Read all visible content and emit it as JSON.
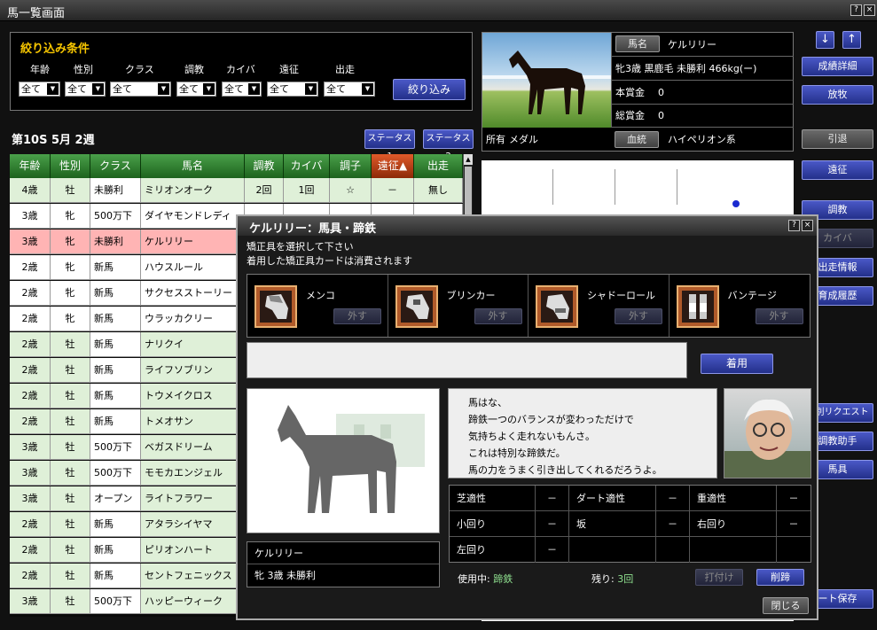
{
  "window": {
    "title": "馬一覧画面",
    "help": "?",
    "close": "×"
  },
  "filter": {
    "title": "絞り込み条件",
    "labels": [
      "年齢",
      "性別",
      "クラス",
      "調教",
      "カイバ",
      "遠征",
      "出走"
    ],
    "values": [
      "全て",
      "全て",
      "全て",
      "全て",
      "全て",
      "全て",
      "全て"
    ],
    "button": "絞り込み"
  },
  "period": "第10S  5月 2週",
  "status_buttons": {
    "s1": "ステータス1",
    "s2": "ステータス2"
  },
  "table": {
    "headers": [
      "年齢",
      "性別",
      "クラス",
      "馬名",
      "調教",
      "カイバ",
      "調子",
      "遠征▲",
      "出走"
    ],
    "rows": [
      {
        "age": "4歳",
        "sex": "牡",
        "cls": "未勝利",
        "name": "ミリオンオーク",
        "train": "2回",
        "feed": "1回",
        "cond": "☆",
        "exp": "－",
        "run": "無し"
      },
      {
        "age": "3歳",
        "sex": "牝",
        "cls": "500万下",
        "name": "ダイヤモンドレディ"
      },
      {
        "age": "3歳",
        "sex": "牝",
        "cls": "未勝利",
        "name": "ケルリリー"
      },
      {
        "age": "2歳",
        "sex": "牝",
        "cls": "新馬",
        "name": "ハウスルール"
      },
      {
        "age": "2歳",
        "sex": "牝",
        "cls": "新馬",
        "name": "サクセスストーリー"
      },
      {
        "age": "2歳",
        "sex": "牝",
        "cls": "新馬",
        "name": "ウラッカクリー"
      },
      {
        "age": "2歳",
        "sex": "牡",
        "cls": "新馬",
        "name": "ナリクイ"
      },
      {
        "age": "2歳",
        "sex": "牡",
        "cls": "新馬",
        "name": "ライフソブリン"
      },
      {
        "age": "2歳",
        "sex": "牡",
        "cls": "新馬",
        "name": "トウメイクロス"
      },
      {
        "age": "2歳",
        "sex": "牡",
        "cls": "新馬",
        "name": "トメオサン"
      },
      {
        "age": "3歳",
        "sex": "牡",
        "cls": "500万下",
        "name": "ベガスドリーム"
      },
      {
        "age": "3歳",
        "sex": "牡",
        "cls": "500万下",
        "name": "モモカエンジェル"
      },
      {
        "age": "3歳",
        "sex": "牡",
        "cls": "オープン",
        "name": "ライトフラワー"
      },
      {
        "age": "2歳",
        "sex": "牡",
        "cls": "新馬",
        "name": "アタラシイヤマ"
      },
      {
        "age": "2歳",
        "sex": "牡",
        "cls": "新馬",
        "name": "ピリオンハート"
      },
      {
        "age": "2歳",
        "sex": "牡",
        "cls": "新馬",
        "name": "セントフェニックス"
      },
      {
        "age": "3歳",
        "sex": "牡",
        "cls": "500万下",
        "name": "ハッピーウィーク"
      }
    ]
  },
  "info": {
    "name_label": "馬名",
    "name": "ケルリリー",
    "desc": "牝3歳 黒鹿毛 未勝利 466kg(ー)",
    "prize_label": "本賞金",
    "prize": "0",
    "total_label": "総賞金",
    "total": "0",
    "owner_label": "所有",
    "owner": "メダル",
    "blood_label": "血統",
    "blood": "ハイペリオン系"
  },
  "right_buttons": [
    "成績詳細",
    "放牧",
    "引退",
    "遠征",
    "調教",
    "カイバ",
    "出走情報",
    "育成履歴",
    "個別リクエスト",
    "調教助手",
    "馬具",
    "ート保存"
  ],
  "dialog": {
    "title": "ケルリリー：馬具・蹄鉄",
    "msg1": "矯正具を選択して下さい",
    "msg2": "着用した矯正具カードは消費されます",
    "slots": [
      {
        "name": "メンコ",
        "off": "外す"
      },
      {
        "name": "ブリンカー",
        "off": "外す"
      },
      {
        "name": "シャドーロール",
        "off": "外す"
      },
      {
        "name": "バンテージ",
        "off": "外す"
      }
    ],
    "wear": "着用",
    "horse_name": "ケルリリー",
    "horse_desc": "牝 3歳 未勝利",
    "quote": [
      "馬はな、",
      "蹄鉄一つのバランスが変わっただけで",
      "気持ちよく走れないもんさ。",
      "これは特別な蹄鉄だ。",
      "馬の力をうまく引き出してくれるだろうよ。"
    ],
    "apt": {
      "turf": "芝適性",
      "dirt": "ダート適性",
      "heavy": "重適性",
      "small": "小回り",
      "slope": "坂",
      "right": "右回り",
      "left": "左回り",
      "dash": "－"
    },
    "using_label": "使用中:",
    "using": "蹄鉄",
    "remain_label": "残り:",
    "remain": "3回",
    "attach": "打付け",
    "remove": "削蹄",
    "close": "閉じる"
  },
  "colors": {
    "selected_row": "#ffb4b4",
    "green_row": "#dff0d8",
    "white_row": "#ffffff",
    "accent": "#f5c400"
  }
}
